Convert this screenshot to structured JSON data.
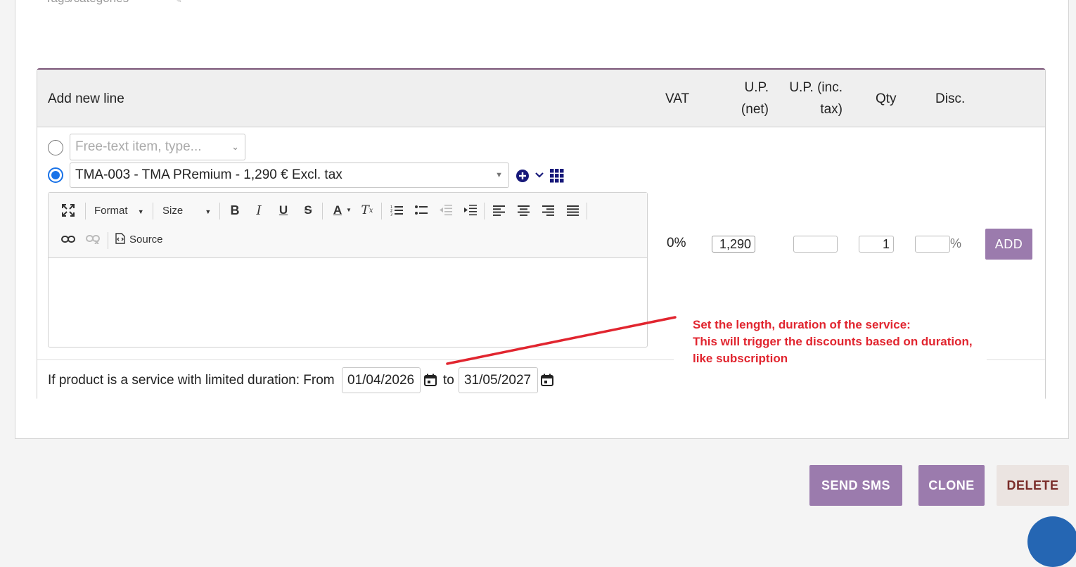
{
  "top": {
    "tags_label": "Tags/categories"
  },
  "line_header": {
    "title": "Add new line",
    "vat": "VAT",
    "up_net": "U.P. (net)",
    "up_inc": "U.P. (inc. tax)",
    "qty": "Qty",
    "disc": "Disc."
  },
  "free_text": {
    "placeholder": "Free-text item, type..."
  },
  "product": {
    "selected": "TMA-003 - TMA PRemium - 1,290 € Excl. tax"
  },
  "editor": {
    "format_label": "Format",
    "size_label": "Size",
    "source_label": "Source"
  },
  "line_values": {
    "vat": "0%",
    "up_net": "1,290",
    "up_inc": "",
    "qty": "1",
    "disc": "",
    "disc_suffix": "%",
    "add_label": "ADD"
  },
  "duration": {
    "label": "If product is a service with limited duration: From",
    "from": "01/04/2026",
    "to_label": "to",
    "to": "31/05/2027"
  },
  "note": {
    "line1": "Set the length, duration of the service:",
    "line2": "This will trigger the discounts based on duration,",
    "line3": "like subscription"
  },
  "actions": {
    "send_sms": "SEND SMS",
    "clone": "CLONE",
    "delete": "DELETE"
  },
  "colors": {
    "accent": "#9b7bad",
    "radio": "#1a73e8",
    "note": "#e1252f",
    "delete_text": "#7a2d2a"
  }
}
